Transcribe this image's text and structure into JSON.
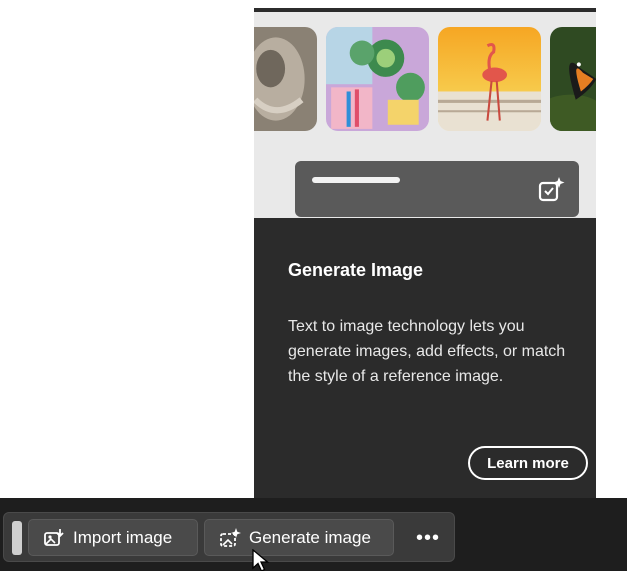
{
  "panel": {
    "title": "Generate Image",
    "description": "Text to image technology lets you generate images, add effects, or match the style of a reference image.",
    "learn_more_label": "Learn more"
  },
  "toolbar": {
    "import_label": "Import image",
    "generate_label": "Generate image",
    "more_label": "•••"
  },
  "icons": {
    "import": "import-image-icon",
    "generate": "generate-image-icon",
    "prompt": "prompt-sparkle-icon",
    "more": "more-icon"
  }
}
